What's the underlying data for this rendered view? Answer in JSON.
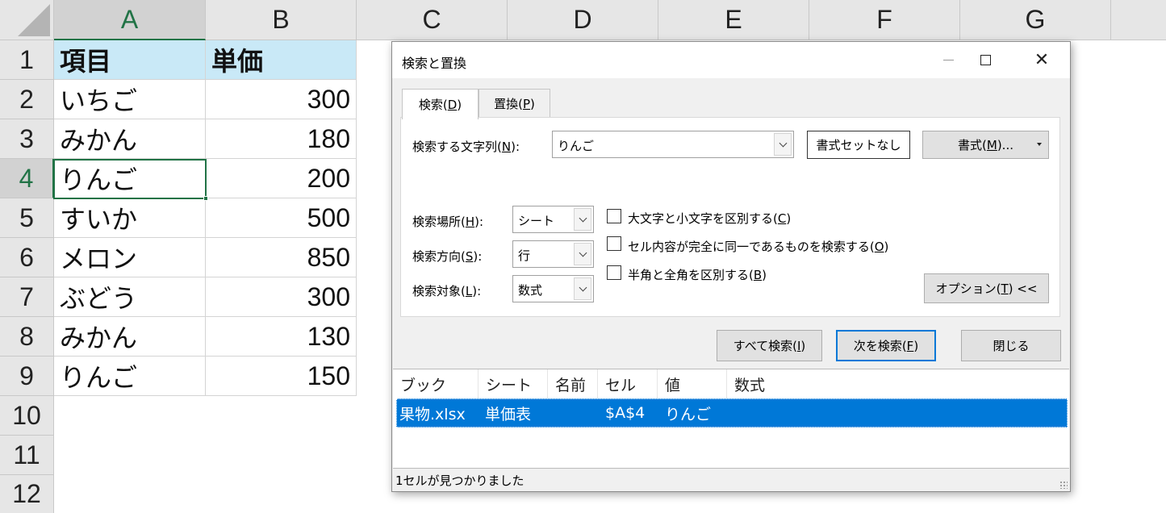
{
  "sheet": {
    "columns": [
      "A",
      "B",
      "C",
      "D",
      "E",
      "F",
      "G"
    ],
    "rows": [
      "1",
      "2",
      "3",
      "4",
      "5",
      "6",
      "7",
      "8",
      "9",
      "10",
      "11",
      "12"
    ],
    "header": {
      "item": "項目",
      "price": "単価"
    },
    "data": [
      {
        "item": "いちご",
        "price": "300"
      },
      {
        "item": "みかん",
        "price": "180"
      },
      {
        "item": "りんご",
        "price": "200"
      },
      {
        "item": "すいか",
        "price": "500"
      },
      {
        "item": "メロン",
        "price": "850"
      },
      {
        "item": "ぶどう",
        "price": "300"
      },
      {
        "item": "みかん",
        "price": "130"
      },
      {
        "item": "りんご",
        "price": "150"
      }
    ],
    "active_cell": "A4"
  },
  "dialog": {
    "title": "検索と置換",
    "tabs": {
      "find": {
        "label": "検索(",
        "key": "D",
        "end": ")"
      },
      "replace": {
        "label": "置換(",
        "key": "P",
        "end": ")"
      }
    },
    "find_what": {
      "label": "検索する文字列(",
      "key": "N",
      "end": "):",
      "value": "りんご"
    },
    "no_format_button": "書式セットなし",
    "format_button": {
      "label": "書式(",
      "key": "M",
      "end": ")..."
    },
    "within": {
      "label": "検索場所(",
      "key": "H",
      "end": "):",
      "value": "シート"
    },
    "search": {
      "label": "検索方向(",
      "key": "S",
      "end": "):",
      "value": "行"
    },
    "look_in": {
      "label": "検索対象(",
      "key": "L",
      "end": "):",
      "value": "数式"
    },
    "options": {
      "match_case": {
        "label": "大文字と小文字を区別する(",
        "key": "C",
        "end": ")"
      },
      "match_entire": {
        "label": "セル内容が完全に同一であるものを検索する(",
        "key": "O",
        "end": ")"
      },
      "match_byte": {
        "label": "半角と全角を区別する(",
        "key": "B",
        "end": ")"
      }
    },
    "options_button": {
      "label": "オプション(",
      "key": "T",
      "end": ") <<"
    },
    "find_all_button": {
      "label": "すべて検索(",
      "key": "I",
      "end": ")"
    },
    "find_next_button": {
      "label": "次を検索(",
      "key": "F",
      "end": ")"
    },
    "close_button": "閉じる",
    "results": {
      "columns": [
        "ブック",
        "シート",
        "名前",
        "セル",
        "値",
        "数式"
      ],
      "rows": [
        {
          "book": "果物.xlsx",
          "sheet": "単価表",
          "name": "",
          "cell": "$A$4",
          "value": "りんご",
          "formula": ""
        }
      ]
    },
    "status": "1セルが見つかりました"
  }
}
